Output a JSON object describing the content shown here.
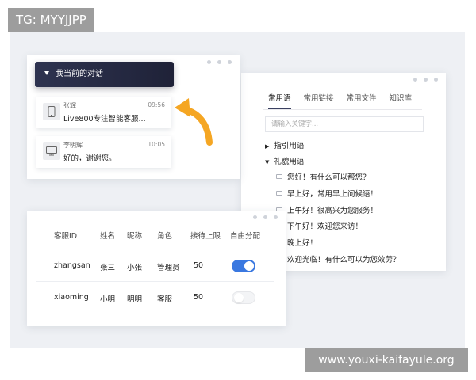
{
  "watermark_top": "TG: MYYJJPP",
  "watermark_bottom": "www.youxi-kaifayule.org",
  "conversations": {
    "header": "我当前的对话",
    "items": [
      {
        "name": "张辉",
        "message": "Live800专注智能客服...",
        "time": "09:56",
        "device_icon": "mobile-icon"
      },
      {
        "name": "李明辉",
        "message": "好的，谢谢您。",
        "time": "10:05",
        "device_icon": "desktop-icon"
      }
    ]
  },
  "phrases": {
    "tabs": [
      "常用语",
      "常用链接",
      "常用文件",
      "知识库"
    ],
    "active_tab": "常用语",
    "search_placeholder": "请输入关键字...",
    "groups": [
      {
        "label": "指引用语",
        "expanded": false
      },
      {
        "label": "礼貌用语",
        "expanded": true
      }
    ],
    "items": [
      "您好！有什么可以帮您？",
      "早上好，常用早上问候语！",
      "上午好！很高兴为您服务！",
      "下午好！欢迎您来访！",
      "晚上好！",
      "欢迎光临！有什么可以为您效劳？"
    ]
  },
  "agents": {
    "headers": [
      "客服ID",
      "姓名",
      "昵称",
      "角色",
      "接待上限",
      "自由分配"
    ],
    "rows": [
      {
        "id": "zhangsan",
        "name": "张三",
        "nickname": "小张",
        "role": "管理员",
        "limit": "50",
        "auto_assign": true
      },
      {
        "id": "xiaoming",
        "name": "小明",
        "nickname": "明明",
        "role": "客服",
        "limit": "50",
        "auto_assign": false
      }
    ]
  },
  "colors": {
    "accent": "#3a78e0",
    "header_dark": "#2a2e47",
    "arrow": "#f5a623"
  }
}
